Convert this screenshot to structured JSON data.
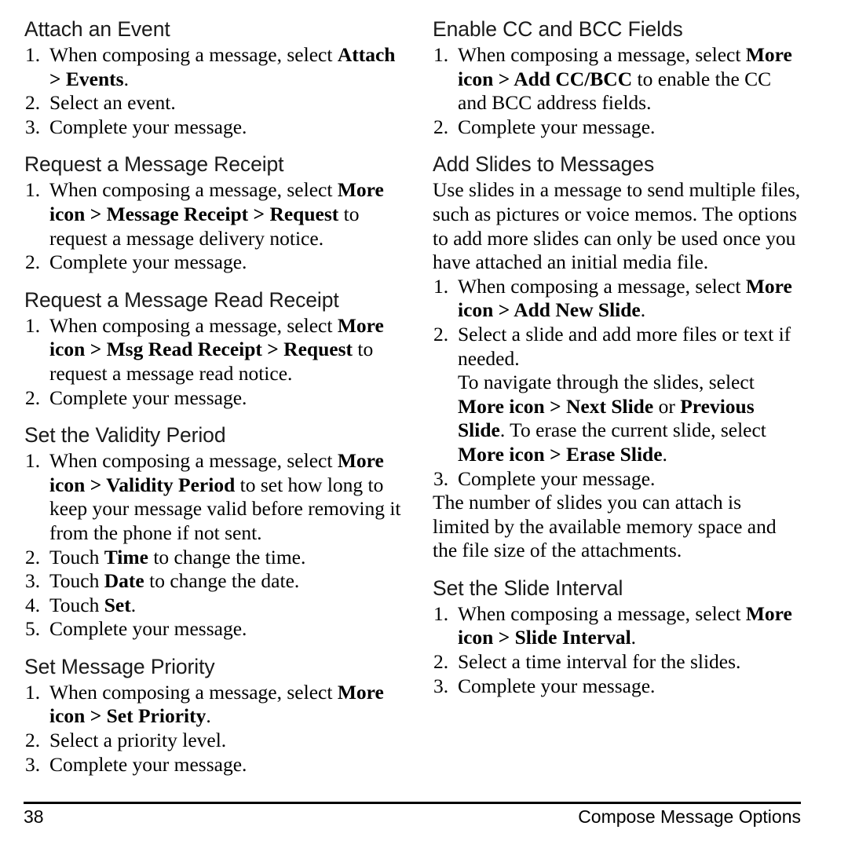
{
  "page": {
    "number": "38",
    "footer_title": "Compose Message Options"
  },
  "left_column": {
    "sections": [
      {
        "heading": "Attach an Event",
        "steps": [
          {
            "num": "1.",
            "parts": [
              {
                "text": "When composing a message, select ",
                "bold": false
              },
              {
                "text": "Attach > Events",
                "bold": true
              },
              {
                "text": ".",
                "bold": false
              }
            ]
          },
          {
            "num": "2.",
            "parts": [
              {
                "text": "Select an event.",
                "bold": false
              }
            ]
          },
          {
            "num": "3.",
            "parts": [
              {
                "text": "Complete your message.",
                "bold": false
              }
            ]
          }
        ]
      },
      {
        "heading": "Request a Message Receipt",
        "steps": [
          {
            "num": "1.",
            "parts": [
              {
                "text": "When composing a message, select ",
                "bold": false
              },
              {
                "text": "More icon > Message Receipt > Request",
                "bold": true
              },
              {
                "text": " to request a message delivery notice.",
                "bold": false
              }
            ]
          },
          {
            "num": "2.",
            "parts": [
              {
                "text": "Complete your message.",
                "bold": false
              }
            ]
          }
        ]
      },
      {
        "heading": "Request a Message Read Receipt",
        "steps": [
          {
            "num": "1.",
            "parts": [
              {
                "text": "When composing a message, select ",
                "bold": false
              },
              {
                "text": "More icon > Msg Read Receipt > Request",
                "bold": true
              },
              {
                "text": " to request a message read notice.",
                "bold": false
              }
            ]
          },
          {
            "num": "2.",
            "parts": [
              {
                "text": "Complete your message.",
                "bold": false
              }
            ]
          }
        ]
      },
      {
        "heading": "Set the Validity Period",
        "steps": [
          {
            "num": "1.",
            "parts": [
              {
                "text": "When composing a message, select ",
                "bold": false
              },
              {
                "text": "More icon > Validity Period",
                "bold": true
              },
              {
                "text": " to set how long to keep your message valid before removing it from the phone if not sent.",
                "bold": false
              }
            ]
          },
          {
            "num": "2.",
            "parts": [
              {
                "text": "Touch ",
                "bold": false
              },
              {
                "text": "Time",
                "bold": true
              },
              {
                "text": " to change the time.",
                "bold": false
              }
            ]
          },
          {
            "num": "3.",
            "parts": [
              {
                "text": "Touch ",
                "bold": false
              },
              {
                "text": "Date",
                "bold": true
              },
              {
                "text": " to change the date.",
                "bold": false
              }
            ]
          },
          {
            "num": "4.",
            "parts": [
              {
                "text": "Touch ",
                "bold": false
              },
              {
                "text": "Set",
                "bold": true
              },
              {
                "text": ".",
                "bold": false
              }
            ]
          },
          {
            "num": "5.",
            "parts": [
              {
                "text": "Complete your message.",
                "bold": false
              }
            ]
          }
        ]
      },
      {
        "heading": "Set Message Priority",
        "steps": [
          {
            "num": "1.",
            "parts": [
              {
                "text": "When composing a message, select ",
                "bold": false
              },
              {
                "text": "More icon > Set Priority",
                "bold": true
              },
              {
                "text": ".",
                "bold": false
              }
            ]
          },
          {
            "num": "2.",
            "parts": [
              {
                "text": "Select a priority level.",
                "bold": false
              }
            ]
          },
          {
            "num": "3.",
            "parts": [
              {
                "text": "Complete your message.",
                "bold": false
              }
            ]
          }
        ]
      }
    ]
  },
  "right_column": {
    "sections": [
      {
        "heading": "Enable CC and BCC Fields",
        "steps": [
          {
            "num": "1.",
            "parts": [
              {
                "text": "When composing a message, select ",
                "bold": false
              },
              {
                "text": "More icon > Add CC/BCC",
                "bold": true
              },
              {
                "text": " to enable the CC and BCC address fields.",
                "bold": false
              }
            ]
          },
          {
            "num": "2.",
            "parts": [
              {
                "text": "Complete your message.",
                "bold": false
              }
            ]
          }
        ]
      },
      {
        "heading": "Add Slides to Messages",
        "intro": "Use slides in a message to send multiple files, such as pictures or voice memos. The options to add more slides can only be used once you have attached an initial media file.",
        "steps": [
          {
            "num": "1.",
            "parts": [
              {
                "text": "When composing a message, select ",
                "bold": false
              },
              {
                "text": "More icon > Add New Slide",
                "bold": true
              },
              {
                "text": ".",
                "bold": false
              }
            ]
          },
          {
            "num": "2.",
            "parts": [
              {
                "text": "Select a slide and add more files or text if needed.",
                "bold": false
              }
            ],
            "sub_parts": [
              {
                "text": "To navigate through the slides, select ",
                "bold": false
              },
              {
                "text": "More icon > Next Slide",
                "bold": true
              },
              {
                "text": " or ",
                "bold": false
              },
              {
                "text": "Previous Slide",
                "bold": true
              },
              {
                "text": ". To erase the current slide, select ",
                "bold": false
              },
              {
                "text": "More icon > Erase Slide",
                "bold": true
              },
              {
                "text": ".",
                "bold": false
              }
            ]
          },
          {
            "num": "3.",
            "parts": [
              {
                "text": "Complete your message.",
                "bold": false
              }
            ]
          }
        ],
        "outro": "The number of slides you can attach is limited by the available memory space and the file size of the attachments."
      },
      {
        "heading": "Set the Slide Interval",
        "steps": [
          {
            "num": "1.",
            "parts": [
              {
                "text": "When composing a message, select ",
                "bold": false
              },
              {
                "text": "More icon > Slide Interval",
                "bold": true
              },
              {
                "text": ".",
                "bold": false
              }
            ]
          },
          {
            "num": "2.",
            "parts": [
              {
                "text": "Select a time interval for the slides.",
                "bold": false
              }
            ]
          },
          {
            "num": "3.",
            "parts": [
              {
                "text": "Complete your message.",
                "bold": false
              }
            ]
          }
        ]
      }
    ]
  }
}
